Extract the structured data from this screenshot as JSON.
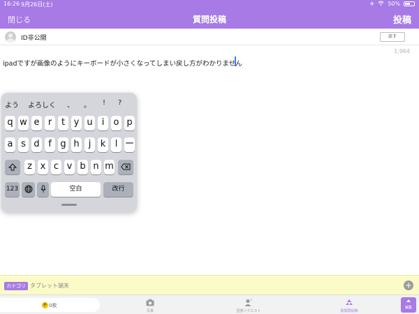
{
  "status_bar": {
    "time": "16:26",
    "date": "9月26日(土)",
    "battery": "50%"
  },
  "nav": {
    "close_label": "閉じる",
    "title": "質問投稿",
    "post_label": "投稿"
  },
  "author": {
    "name": "ID非公開",
    "back_label": "戻す"
  },
  "editor": {
    "char_count": "1,964",
    "text": "ipadですが画像のようにキーボードが小さくなってしまい戻し方がわかりません"
  },
  "keyboard": {
    "suggestions": [
      "よう",
      "よろしく",
      "、",
      "。",
      "!",
      "?"
    ],
    "row1": [
      "q",
      "w",
      "e",
      "r",
      "t",
      "y",
      "u",
      "i",
      "o",
      "p"
    ],
    "row2": [
      "a",
      "s",
      "d",
      "f",
      "g",
      "h",
      "j",
      "k",
      "l",
      "ー"
    ],
    "row3": [
      "z",
      "x",
      "c",
      "v",
      "b",
      "n",
      "m"
    ],
    "numbers_label": "123",
    "space_label": "空白",
    "return_label": "改行"
  },
  "category": {
    "badge": "カテゴリ",
    "value": "タブレット端末"
  },
  "tabbar": {
    "coin_icon": "チ",
    "coins": "0枚",
    "photo_label": "写真",
    "request_label": "回答リクエスト",
    "recruit_label": "質問再投稿",
    "edit_label": "編集"
  },
  "colors": {
    "accent": "#a77ae6",
    "category_bg": "#fafbc6",
    "keyboard_bg": "#d4d6dc"
  }
}
